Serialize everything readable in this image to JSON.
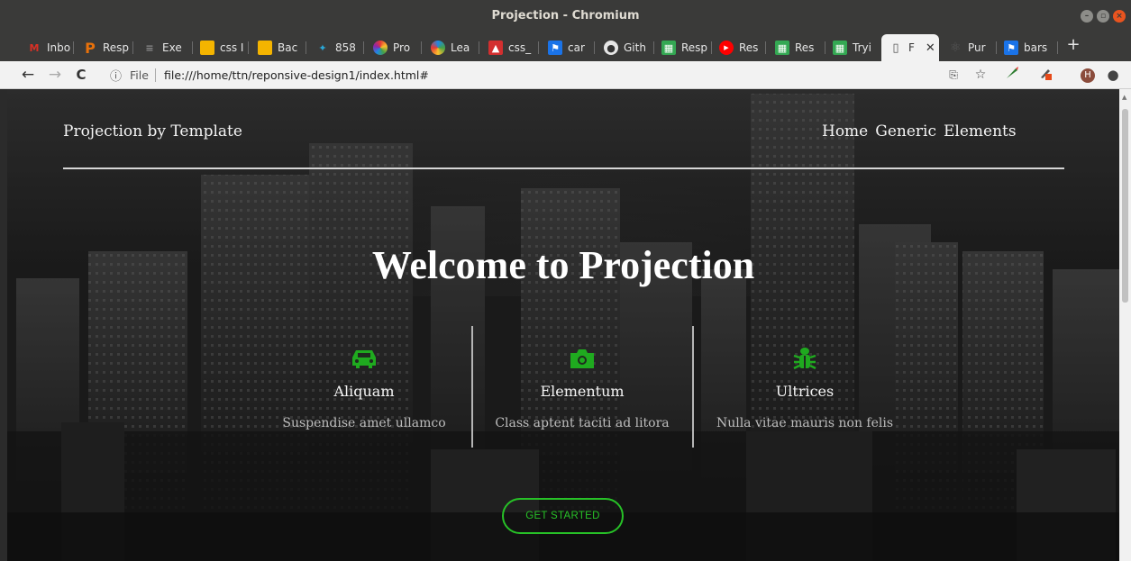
{
  "window": {
    "title": "Projection - Chromium"
  },
  "tabs": [
    {
      "label": "Inbo",
      "icon": "gmail-icon",
      "color": "#d93025",
      "glyph": "M"
    },
    {
      "label": "Resp",
      "icon": "p-logo-icon",
      "color": "#e8710a",
      "glyph": "P"
    },
    {
      "label": "Exe",
      "icon": "list-icon",
      "color": "#8a8a8a",
      "glyph": "≡"
    },
    {
      "label": "css I",
      "icon": "slides-icon",
      "color": "#f4b400",
      "glyph": "▭"
    },
    {
      "label": "Bac",
      "icon": "slides-icon",
      "color": "#f4b400",
      "glyph": "▭"
    },
    {
      "label": "858",
      "icon": "star-burst-icon",
      "color": "#2aa8d8",
      "glyph": "✦"
    },
    {
      "label": "Pro",
      "icon": "colorwheel-icon",
      "color": "#7b3fb5",
      "glyph": "◉"
    },
    {
      "label": "Lea",
      "icon": "colorwheel-icon",
      "color": "#1b8bd4",
      "glyph": "◉"
    },
    {
      "label": "css_",
      "icon": "mountain-icon",
      "color": "#d32f2f",
      "glyph": "▲"
    },
    {
      "label": "car",
      "icon": "flag-icon",
      "color": "#1a73e8",
      "glyph": "⚑"
    },
    {
      "label": "Gith",
      "icon": "github-icon",
      "color": "#444444",
      "glyph": "●"
    },
    {
      "label": "Resp",
      "icon": "sheet-icon",
      "color": "#34a853",
      "glyph": "▦"
    },
    {
      "label": "Res",
      "icon": "youtube-icon",
      "color": "#ff0000",
      "glyph": "▶"
    },
    {
      "label": "Res",
      "icon": "sheet-icon",
      "color": "#34a853",
      "glyph": "▦"
    },
    {
      "label": "Tryi",
      "icon": "sheet-icon",
      "color": "#34a853",
      "glyph": "▦"
    },
    {
      "label": "F",
      "icon": "page-icon",
      "color": "#f2f2f2",
      "glyph": "▯",
      "active": true
    },
    {
      "label": "Pur",
      "icon": "react-icon",
      "color": "#3a3a39",
      "glyph": "⚛"
    },
    {
      "label": "bars",
      "icon": "flag-icon",
      "color": "#1a73e8",
      "glyph": "⚑"
    }
  ],
  "toolbar": {
    "back": "←",
    "forward": "→",
    "reload": "C",
    "info": "ⓘ",
    "file_label": "File",
    "url": "file:///home/ttn/reponsive-design1/index.html#",
    "avatar_letter": "H"
  },
  "site": {
    "logo": "Projection by Template",
    "nav": [
      "Home",
      "Generic",
      "Elements"
    ],
    "hero_title": "Welcome to Projection",
    "features": [
      {
        "name": "Aliquam",
        "desc": "Suspendise amet ullamco",
        "icon": "car-icon"
      },
      {
        "name": "Elementum",
        "desc": "Class aptent taciti ad litora",
        "icon": "camera-icon"
      },
      {
        "name": "Ultrices",
        "desc": "Nulla vitae mauris non felis",
        "icon": "bug-icon"
      }
    ],
    "cta": "GET STARTED",
    "accent_color": "#27c127"
  }
}
